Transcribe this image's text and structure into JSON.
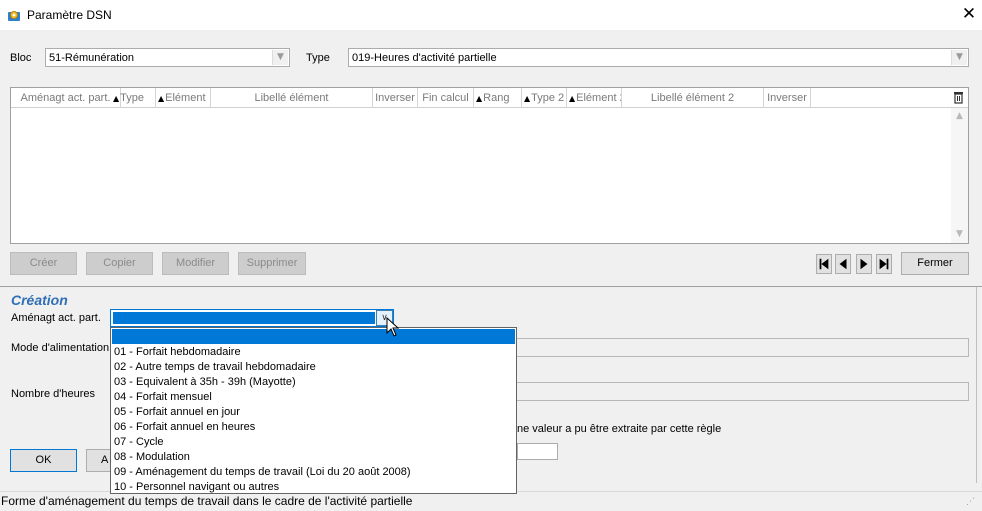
{
  "window": {
    "title": "Paramètre DSN",
    "close_glyph": "✕",
    "icon": "app-gear-icon"
  },
  "filters": {
    "bloc_label": "Bloc",
    "bloc_value": "51-Rémunération",
    "type_label": "Type",
    "type_value": "019-Heures d'activité partielle"
  },
  "grid": {
    "columns": [
      {
        "label": "Aménagt act. part.",
        "sort": false
      },
      {
        "label": "Type",
        "sort": true
      },
      {
        "label": "Elément",
        "sort": true
      },
      {
        "label": "Libellé élément",
        "sort": false
      },
      {
        "label": "Inverser",
        "sort": false
      },
      {
        "label": "Fin calcul",
        "sort": false
      },
      {
        "label": "Rang",
        "sort": true
      },
      {
        "label": "Type 2",
        "sort": true
      },
      {
        "label": "Elément 2",
        "sort": true
      },
      {
        "label": "Libellé élément 2",
        "sort": false
      },
      {
        "label": "Inverser",
        "sort": false
      }
    ],
    "rows": []
  },
  "actions": {
    "create": "Créer",
    "copy": "Copier",
    "modify": "Modifier",
    "delete": "Supprimer",
    "close": "Fermer"
  },
  "creation": {
    "title": "Création",
    "amenagt_label": "Aménagt act. part.",
    "mode_label": "Mode d'alimentation",
    "hours_label": "Nombre d'heures",
    "rule_note": "ne valeur a pu être extraite par cette règle",
    "ok": "OK",
    "cancel_partial": "A"
  },
  "dropdown": {
    "selected_index": 0,
    "options": [
      "",
      "01 - Forfait hebdomadaire",
      "02 - Autre temps de travail hebdomadaire",
      "03 - Equivalent à 35h - 39h (Mayotte)",
      "04 - Forfait mensuel",
      "05 - Forfait annuel en jour",
      "06 - Forfait annuel en heures",
      "07 - Cycle",
      "08 - Modulation",
      "09 - Aménagement du temps de travail (Loi du 20 août 2008)",
      "10 - Personnel navigant ou autres"
    ]
  },
  "status": {
    "text": "Forme d'aménagement du temps de travail dans le cadre de l'activité partielle"
  },
  "colors": {
    "accent": "#2f6fb6",
    "selection": "#0078d7"
  }
}
